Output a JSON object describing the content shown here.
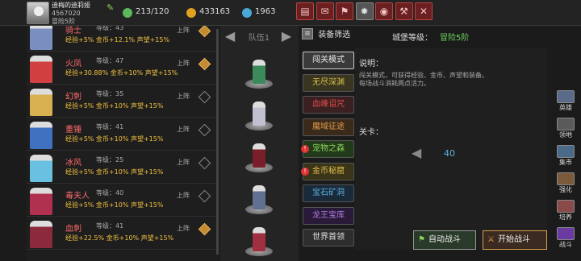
{
  "player": {
    "name": "迪梅的迪莉娅",
    "id": "4567020",
    "rank": "冒险5阶"
  },
  "resources": [
    {
      "icon": "energy-icon",
      "value": "213/120",
      "color": "#5cb85c"
    },
    {
      "icon": "gold-coin-icon",
      "value": "433163",
      "color": "#e0a020"
    },
    {
      "icon": "gem-icon",
      "value": "1963",
      "color": "#4aa8d8"
    }
  ],
  "toolbar": [
    {
      "name": "shop-button",
      "glyph": "▤"
    },
    {
      "name": "mail-button",
      "glyph": "✉"
    },
    {
      "name": "rank-button",
      "glyph": "⚑"
    },
    {
      "name": "settings-button",
      "glyph": "✹"
    },
    {
      "name": "event-button",
      "glyph": "◉"
    },
    {
      "name": "gift-button",
      "glyph": "⚒"
    },
    {
      "name": "disabled-button",
      "glyph": "✕"
    }
  ],
  "heroes": [
    {
      "name": "骑士",
      "level": "等级：43",
      "stats": "经验+5%  金币+12.1%  声望+15%",
      "deploy": "上阵",
      "selected": true,
      "color": "#7a8fbf"
    },
    {
      "name": "火凤",
      "level": "等级：47",
      "stats": "经验+30.88%  金币+10%  声望+15%",
      "deploy": "上阵",
      "selected": true,
      "color": "#d04040"
    },
    {
      "name": "幻刺",
      "level": "等级：35",
      "stats": "经验+5%  金币+10%  声望+15%",
      "deploy": "上阵",
      "selected": false,
      "color": "#d8b050"
    },
    {
      "name": "重锤",
      "level": "等级：41",
      "stats": "经验+5%  金币+10%  声望+15%",
      "deploy": "上阵",
      "selected": false,
      "color": "#4070c0"
    },
    {
      "name": "冰风",
      "level": "等级：25",
      "stats": "经验+5%  金币+10%  声望+15%",
      "deploy": "上阵",
      "selected": false,
      "color": "#6ac0e0"
    },
    {
      "name": "毒夫人",
      "level": "等级：40",
      "stats": "经验+5%  金币+10%  声望+15%",
      "deploy": "上阵",
      "selected": false,
      "color": "#b03050"
    },
    {
      "name": "血刺",
      "level": "等级：41",
      "stats": "经验+22.5%  金币+10%  声望+15%",
      "deploy": "上阵",
      "selected": true,
      "color": "#8a2a3a"
    }
  ],
  "team": {
    "label": "队伍1",
    "members": [
      "#3a8a5a",
      "#c0c0d0",
      "#7a1f2a",
      "#607090",
      "#a03040"
    ]
  },
  "filter": {
    "title": "装备筛选",
    "castle_label": "城堡等级：",
    "castle_value": "冒险5阶"
  },
  "modes": [
    {
      "label": "闯关模式",
      "selected": true,
      "warn": false,
      "color": "#e8e8e8",
      "bg": "#3a3a3a"
    },
    {
      "label": "无尽深渊",
      "selected": false,
      "warn": false,
      "color": "#d4c04a",
      "bg": "#3a3520"
    },
    {
      "label": "血峰诅咒",
      "selected": false,
      "warn": false,
      "color": "#e04a4a",
      "bg": "#3a2020"
    },
    {
      "label": "魔域征途",
      "selected": false,
      "warn": false,
      "color": "#e09a4a",
      "bg": "#3a2a1a"
    },
    {
      "label": "宠物之森",
      "selected": false,
      "warn": true,
      "color": "#8ad45a",
      "bg": "#223a1a"
    },
    {
      "label": "金币秘窟",
      "selected": false,
      "warn": true,
      "color": "#e0c04a",
      "bg": "#3a3418"
    },
    {
      "label": "宝石矿洞",
      "selected": false,
      "warn": false,
      "color": "#5ab0e0",
      "bg": "#1a2a3a"
    },
    {
      "label": "龙王宝库",
      "selected": false,
      "warn": false,
      "color": "#b07ae0",
      "bg": "#2a1a3a"
    },
    {
      "label": "世界首领",
      "selected": false,
      "warn": false,
      "color": "#e0e0e0",
      "bg": "#2e2e2e"
    }
  ],
  "info": {
    "title": "说明：",
    "desc1": "闯关模式，可获得经验、金币、声望和装备。",
    "desc2": "每场战斗消耗两点活力。",
    "stage_label": "关卡：",
    "stage_value": "40"
  },
  "sidebar": [
    "英雄",
    "领地",
    "集市",
    "强化",
    "培养",
    "战斗"
  ],
  "actions": {
    "auto": "自动战斗",
    "start": "开始战斗"
  }
}
